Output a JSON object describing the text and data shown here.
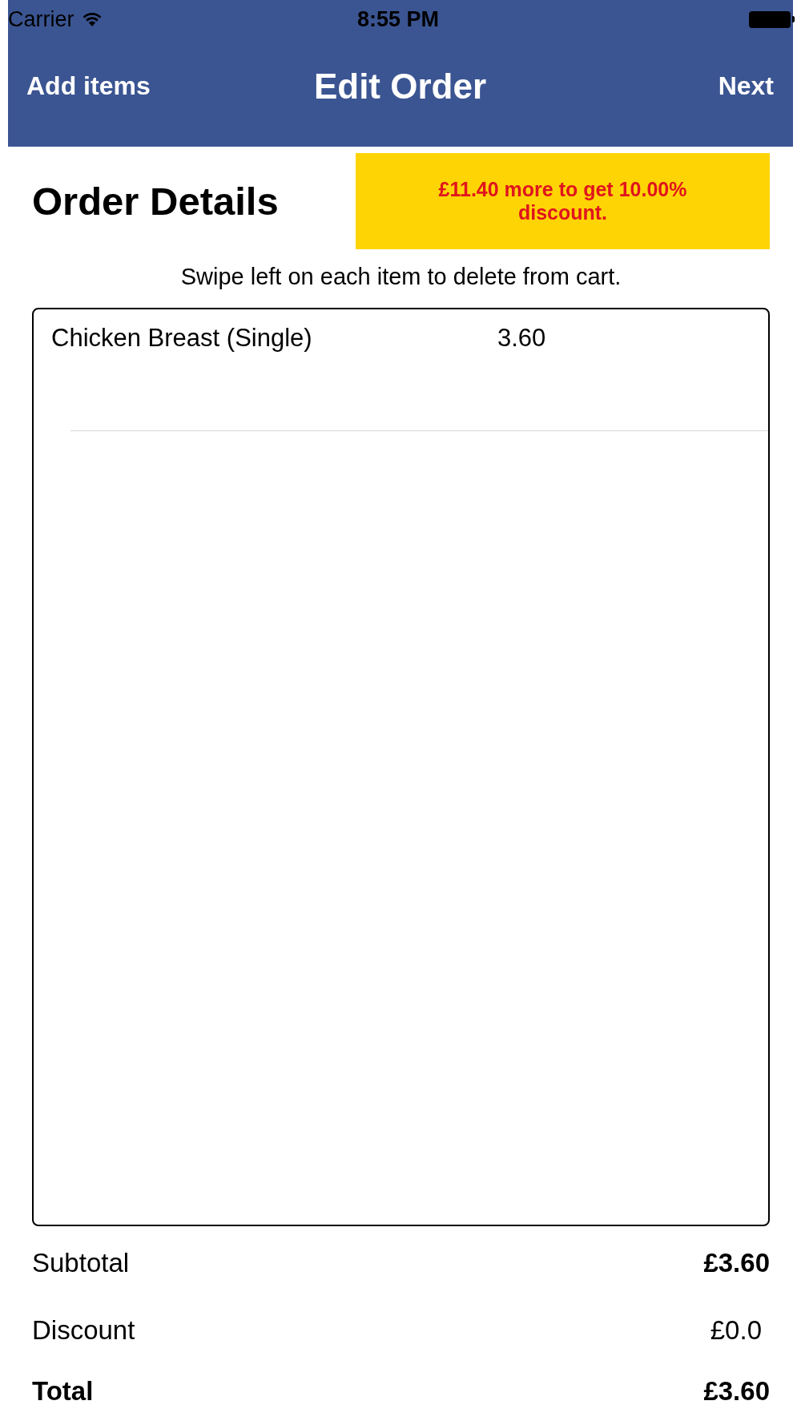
{
  "status_bar": {
    "carrier": "Carrier",
    "time": "8:55 PM"
  },
  "nav_bar": {
    "left": "Add items",
    "title": "Edit Order",
    "right": "Next"
  },
  "header": {
    "title": "Order Details",
    "promo": "£11.40 more to get 10.00% discount."
  },
  "hint": "Swipe left on each item to delete from cart.",
  "cart": {
    "items": [
      {
        "name": "Chicken Breast (Single)",
        "price": "3.60"
      }
    ]
  },
  "summary": [
    {
      "kind": "normal",
      "label": "Subtotal",
      "value": "£3.60",
      "value_bold": true
    },
    {
      "kind": "normal",
      "label": "Discount",
      "value": "£0.0",
      "value_bold": false
    },
    {
      "kind": "total",
      "label": "Total",
      "value": "£3.60",
      "value_bold": true
    }
  ]
}
